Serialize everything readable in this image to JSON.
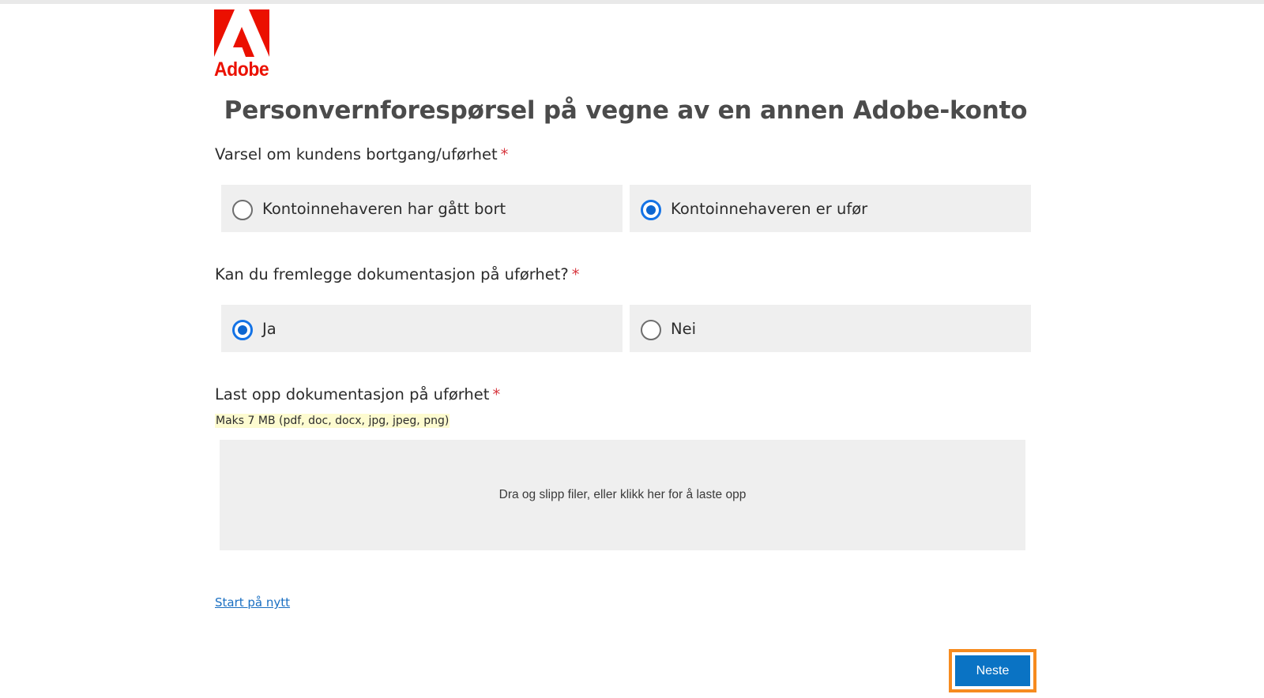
{
  "brand": {
    "logo_text": "Adobe",
    "logo_color": "#eb1000"
  },
  "page": {
    "title": "Personvernforespørsel på vegne av en annen Adobe-konto"
  },
  "question1": {
    "label": "Varsel om kundens bortgang/uførhet",
    "required_marker": "*",
    "options": [
      {
        "label": "Kontoinnehaveren har gått bort",
        "selected": false
      },
      {
        "label": "Kontoinnehaveren er ufør",
        "selected": true
      }
    ]
  },
  "question2": {
    "label": "Kan du fremlegge dokumentasjon på uførhet?",
    "required_marker": "*",
    "options": [
      {
        "label": "Ja",
        "selected": true
      },
      {
        "label": "Nei",
        "selected": false
      }
    ]
  },
  "upload": {
    "label": "Last opp dokumentasjon på uførhet",
    "required_marker": "*",
    "hint": "Maks 7 MB (pdf, doc, docx, jpg, jpeg, png)",
    "dropzone_text": "Dra og slipp filer, eller klikk her for å laste opp"
  },
  "footer": {
    "restart_label": "Start på nytt",
    "next_label": "Neste"
  },
  "colors": {
    "accent": "#0a73c4",
    "radio_selected": "#1473e6",
    "required": "#d7373f",
    "focus_outline": "#f68b1f",
    "option_bg": "#efefef",
    "hint_bg": "#fdfbd0"
  }
}
